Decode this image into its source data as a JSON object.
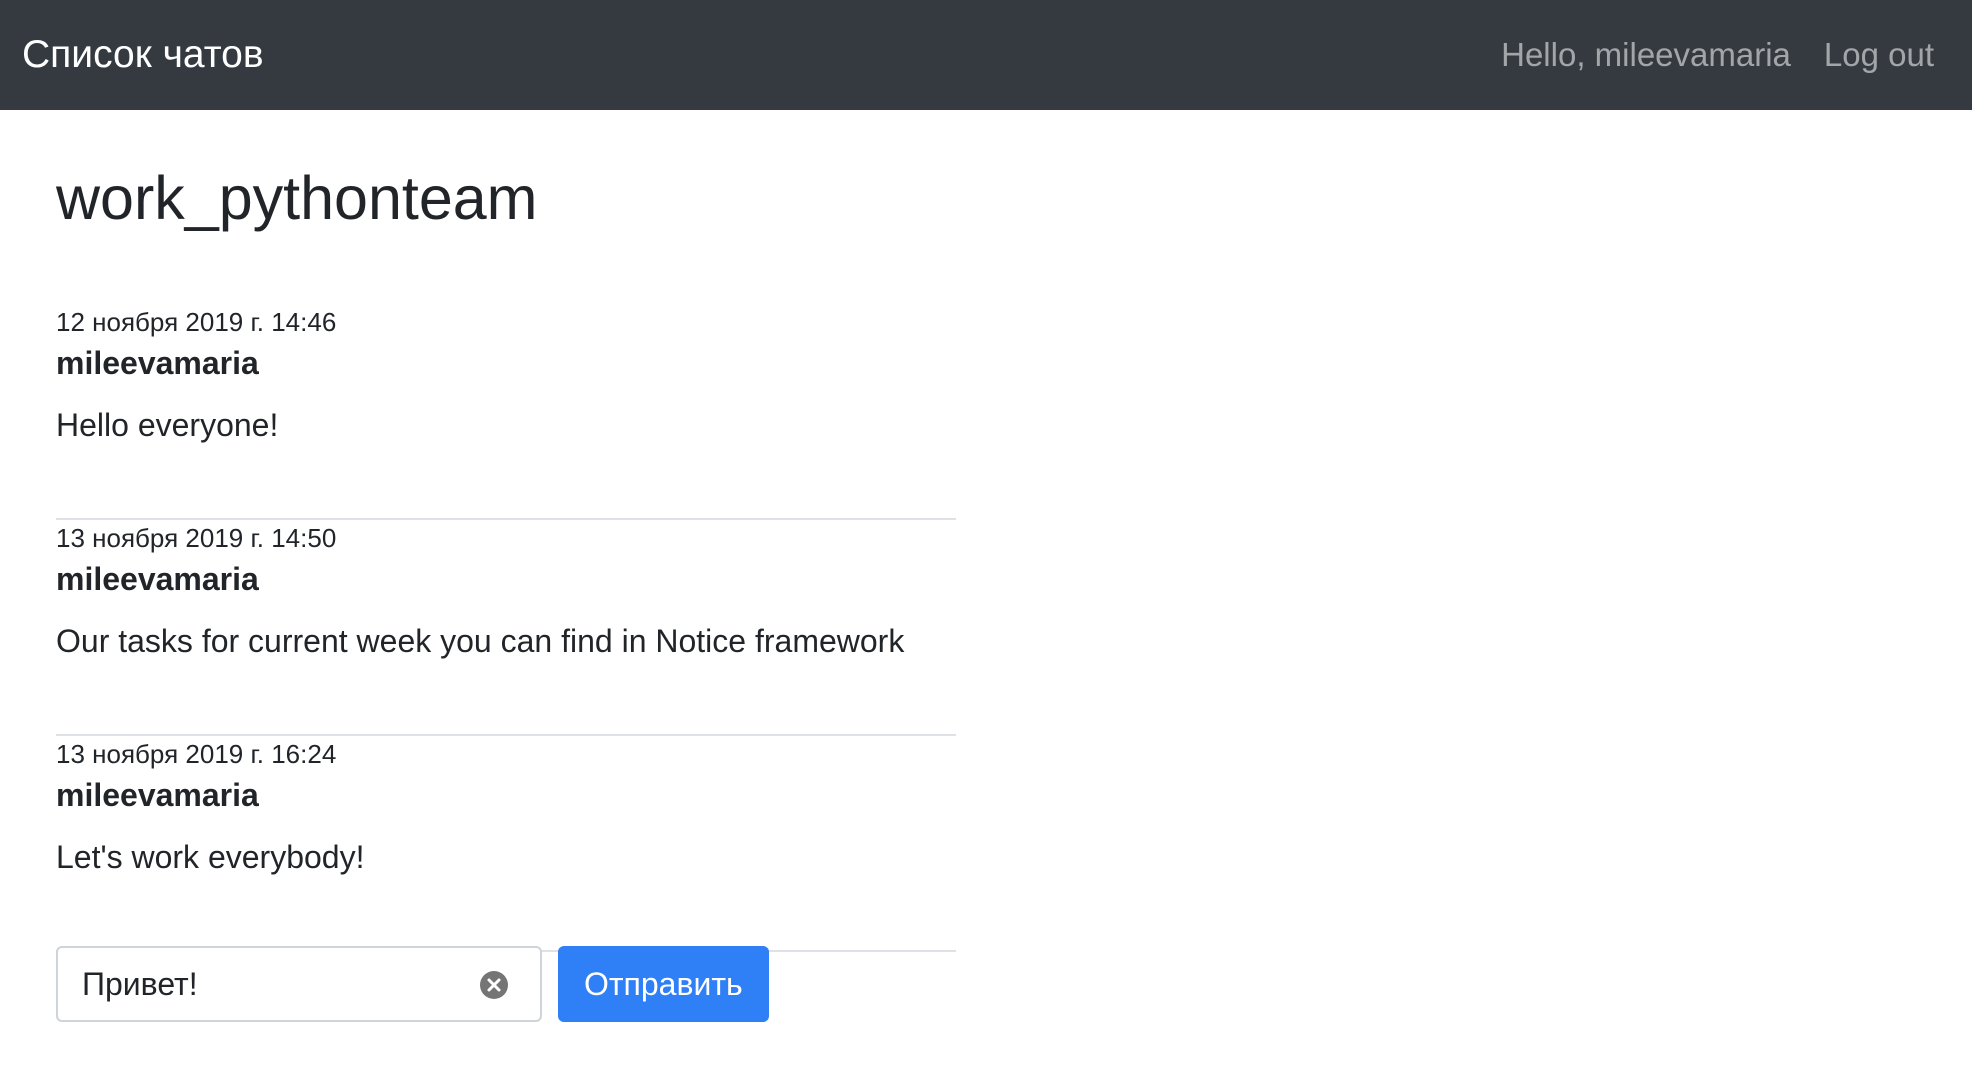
{
  "navbar": {
    "brand": "Список чатов",
    "greeting": "Hello, mileevamaria",
    "logout": "Log out"
  },
  "chat": {
    "title": "work_pythonteam",
    "messages": [
      {
        "date": "12 ноября 2019 г. 14:46",
        "author": "mileevamaria",
        "text": "Hello everyone!"
      },
      {
        "date": "13 ноября 2019 г. 14:50",
        "author": "mileevamaria",
        "text": "Our tasks for current week you can find in Notice framework"
      },
      {
        "date": "13 ноября 2019 г. 16:24",
        "author": "mileevamaria",
        "text": "Let's work everybody!"
      }
    ]
  },
  "form": {
    "input_value": "Привет!",
    "send_label": "Отправить",
    "clear_icon": "clear-circle-icon"
  },
  "colors": {
    "navbar_bg": "#343a40",
    "primary": "#2f7ff7",
    "divider": "#dee2e6"
  }
}
